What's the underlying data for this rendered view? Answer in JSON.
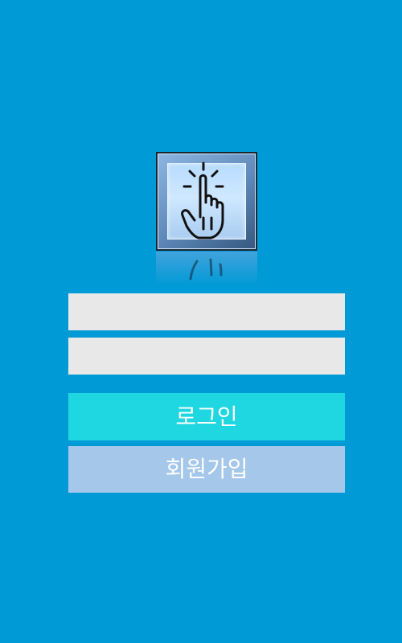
{
  "logo": {
    "icon": "tap-hand-icon",
    "colors": {
      "frame": "#5e88b8",
      "face": "#bcdcff",
      "glyph": "#111111"
    }
  },
  "form": {
    "id_value": "",
    "password_value": ""
  },
  "buttons": {
    "login_label": "로그인",
    "signup_label": "회원가입"
  },
  "colors": {
    "background": "#009ad6",
    "input": "#e8e8e8",
    "login": "#1fd7e0",
    "signup": "#a4c7ea",
    "label": "#ffffff"
  }
}
